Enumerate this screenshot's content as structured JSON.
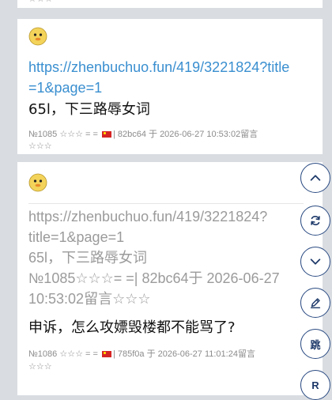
{
  "top_card": {
    "stars": "☆☆☆"
  },
  "posts": [
    {
      "link": "https://zhenbuchuo.fun/419/3221824?title=1&page=1",
      "message": "65l，下三路辱女词",
      "meta_number": "№1085",
      "meta_stars": "☆☆☆ = =",
      "meta_hash": "| 82bc64 于 2026-06-27 10:53:02留言",
      "meta_stars2": "☆☆☆"
    },
    {
      "quote_lines": [
        "https://zhenbuchuo.fun/419/3221824?",
        "title=1&page=1",
        "65l，下三路辱女词",
        "№1085☆☆☆= =| 82bc64于 2026-06-27",
        "10:53:02留言☆☆☆"
      ],
      "message": "申诉，怎么攻嫖毁楼都不能骂了?",
      "meta_number": "№1086",
      "meta_stars": "☆☆☆ = =",
      "meta_hash": "| 785f0a 于 2026-06-27 11:01:24留言",
      "meta_stars2": "☆☆☆"
    }
  ],
  "fab": {
    "jump_label": "跳",
    "r_label": "R"
  }
}
